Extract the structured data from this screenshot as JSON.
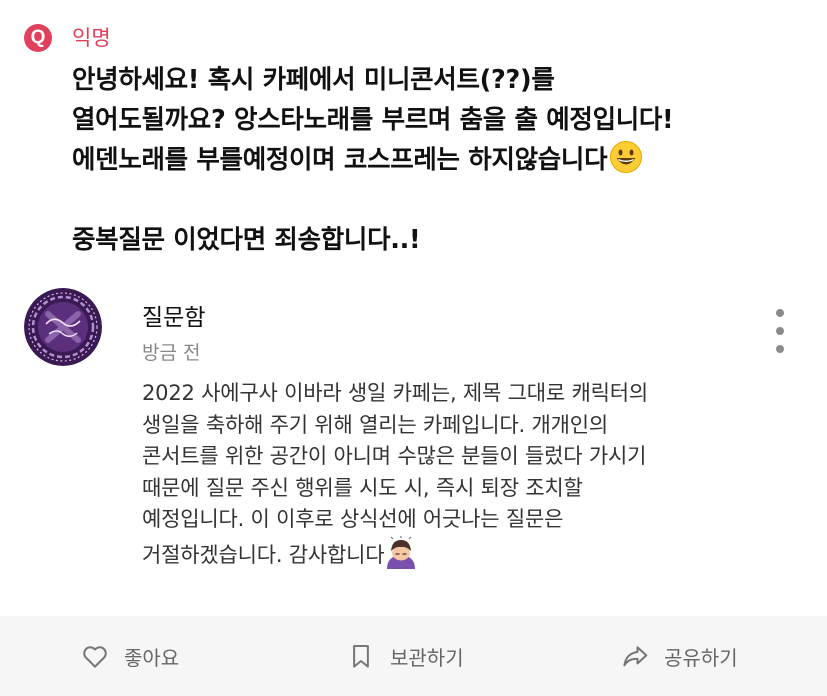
{
  "post": {
    "badge": "Q",
    "author": "익명",
    "question_lines": [
      "안녕하세요! 혹시 카페에서 미니콘서트(??)를",
      "열어도될까요? 앙스타노래를 부르며 춤을 출 예정입니다!",
      "에덴노래를 부를예정이며  코스프레는 하지않습니다",
      "",
      "중복질문 이었다면 죄송합니다..!"
    ]
  },
  "answer": {
    "name": "질문함",
    "time": "방금 전",
    "lines": [
      "2022 사에구사 이바라 생일 카페는, 제목 그대로 캐릭터의",
      "생일을 축하해 주기 위해 열리는 카페입니다. 개개인의",
      "콘서트를 위한 공간이 아니며 수많은 분들이 들렀다 가시기",
      "때문에 질문 주신 행위를 시도 시, 즉시 퇴장 조치할",
      "예정입니다. 이 이후로 상식선에 어긋나는 질문은",
      "거절하겠습니다. 감사합니다"
    ]
  },
  "actions": {
    "like": "좋아요",
    "save": "보관하기",
    "share": "공유하기"
  },
  "icons": {
    "question_badge": "q-badge-icon",
    "question_emoji": "grinning-face-emoji",
    "answer_emoji": "person-bowing-emoji",
    "menu": "more-vertical-icon",
    "like": "heart-outline-icon",
    "save": "bookmark-outline-icon",
    "share": "share-arrow-icon"
  },
  "colors": {
    "accent": "#e0405b",
    "avatar_bg": "#3a1a52",
    "muted_text": "#888888",
    "action_bar": "#f6f6f6"
  }
}
